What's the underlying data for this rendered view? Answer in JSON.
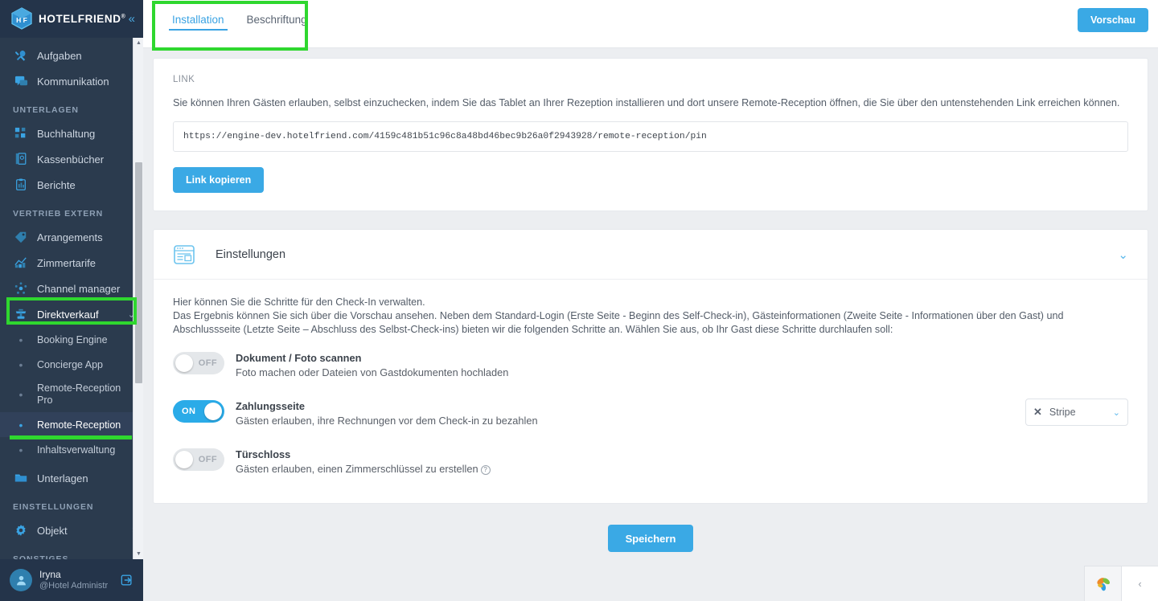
{
  "sidebar": {
    "brand": {
      "name": "HOTELFRIEND",
      "reg": "®",
      "collapse_icon": "chevrons-left-icon"
    },
    "groups": [
      {
        "label": "",
        "items": [
          {
            "label": "Aufgaben",
            "icon": "tools-icon",
            "arrow": ""
          },
          {
            "label": "Kommunikation",
            "icon": "chat-icon",
            "arrow": "›"
          }
        ]
      },
      {
        "label": "UNTERLAGEN",
        "items": [
          {
            "label": "Buchhaltung",
            "icon": "grid-icon",
            "arrow": "›"
          },
          {
            "label": "Kassenbücher",
            "icon": "book-icon",
            "arrow": ""
          },
          {
            "label": "Berichte",
            "icon": "clipboard-icon",
            "arrow": ""
          }
        ]
      },
      {
        "label": "VERTRIEB EXTERN",
        "items": [
          {
            "label": "Arrangements",
            "icon": "tag-icon",
            "arrow": ""
          },
          {
            "label": "Zimmertarife",
            "icon": "chart-icon",
            "arrow": "›"
          },
          {
            "label": "Channel manager",
            "icon": "network-icon",
            "arrow": ""
          },
          {
            "label": "Direktverkauf",
            "icon": "shop-icon",
            "arrow": "⌄",
            "expanded": true
          }
        ],
        "subitems": [
          {
            "label": "Booking Engine",
            "selected": false
          },
          {
            "label": "Concierge App",
            "selected": false
          },
          {
            "label": "Remote-Reception Pro",
            "selected": false,
            "two_line": true
          },
          {
            "label": "Remote-Reception",
            "selected": true
          },
          {
            "label": "Inhaltsverwaltung",
            "selected": false
          }
        ]
      },
      {
        "label": "",
        "items": [
          {
            "label": "Unterlagen",
            "icon": "folder-icon",
            "arrow": ""
          }
        ]
      },
      {
        "label": "EINSTELLUNGEN",
        "items": [
          {
            "label": "Objekt",
            "icon": "gear-icon",
            "arrow": "›"
          }
        ]
      },
      {
        "label": "SONSTIGES",
        "items": []
      }
    ],
    "user": {
      "name": "Iryna",
      "role": "@Hotel Administr",
      "avatar_icon": "user-avatar-icon",
      "logout_icon": "logout-icon"
    }
  },
  "topbar": {
    "tabs": [
      {
        "label": "Installation",
        "active": true
      },
      {
        "label": "Beschriftung",
        "active": false
      }
    ],
    "preview_button": "Vorschau"
  },
  "link_card": {
    "label": "LINK",
    "description": "Sie können Ihren Gästen erlauben, selbst einzuchecken, indem Sie das Tablet an Ihrer Rezeption installieren und dort unsere Remote-Reception öffnen, die Sie über den untenstehenden Link erreichen können.",
    "url": "https://engine-dev.hotelfriend.com/4159c481b51c96c8a48bd46bec9b26a0f2943928/remote-reception/pin",
    "copy_button": "Link kopieren"
  },
  "settings_card": {
    "icon": "settings-page-icon",
    "title": "Einstellungen",
    "collapse_icon": "chevron-down-icon",
    "intro_line1": "Hier können Sie die Schritte für den Check-In verwalten.",
    "intro_line2": "Das Ergebnis können Sie sich über die Vorschau ansehen. Neben dem Standard-Login (Erste Seite - Beginn des Self-Check-in), Gästeinformationen (Zweite Seite - Informationen über den Gast) und Abschlussseite (Letzte Seite – Abschluss des Selbst-Check-ins) bieten wir die folgenden Schritte an. Wählen Sie aus, ob Ihr Gast diese Schritte durchlaufen soll:",
    "rows": [
      {
        "toggle_state": "OFF",
        "title": "Dokument / Foto scannen",
        "subtitle": "Foto machen oder Dateien von Gastdokumenten hochladen",
        "has_info": false,
        "has_select": false
      },
      {
        "toggle_state": "ON",
        "title": "Zahlungsseite",
        "subtitle": "Gästen erlauben, ihre Rechnungen vor dem Check-in zu bezahlen",
        "has_info": false,
        "has_select": true,
        "select_value": "Stripe",
        "select_clear_icon": "close-icon",
        "select_chevron_icon": "chevron-down-icon"
      },
      {
        "toggle_state": "OFF",
        "title": "Türschloss",
        "subtitle": "Gästen erlauben, einen Zimmerschlüssel zu erstellen",
        "has_info": true,
        "info_icon": "info-icon",
        "has_select": false
      }
    ]
  },
  "save_button": "Speichern",
  "widget": {
    "flower_icon": "flower-widget-icon",
    "collapse_icon": "chevron-left-icon"
  },
  "colors": {
    "accent": "#3aa9e5",
    "toggle_on": "#2aabe8",
    "sidebar_bg": "#2b3b4e",
    "sidebar_dark": "#24344a",
    "annotation": "#2fd72f"
  }
}
